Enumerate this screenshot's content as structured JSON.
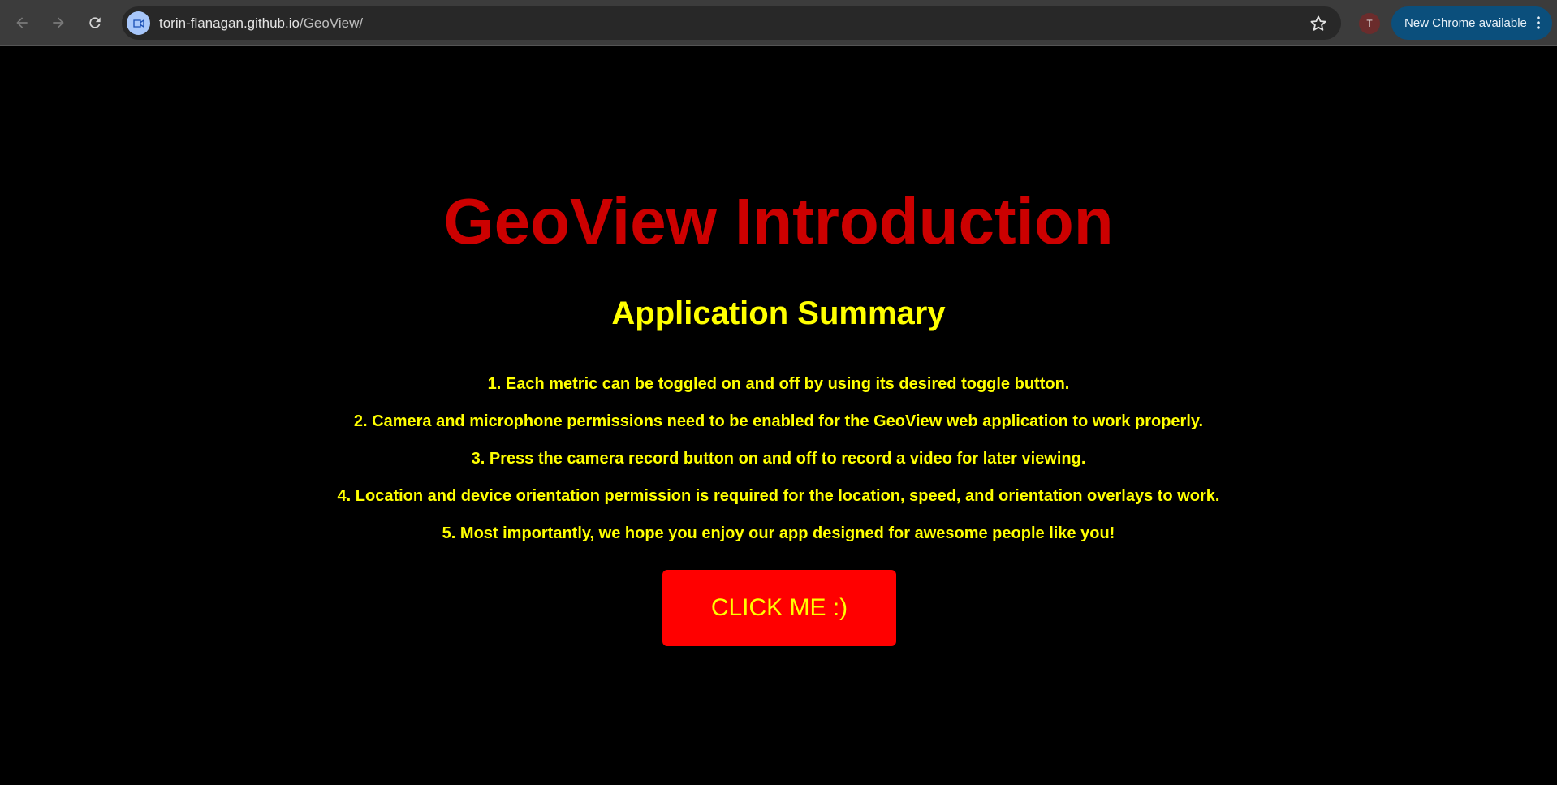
{
  "browser": {
    "url_host": "torin-flanagan.github.io",
    "url_path": "/GeoView/",
    "avatar_letter": "T",
    "update_label": "New Chrome available",
    "icons": {
      "back": "arrow-left-icon",
      "forward": "arrow-right-icon",
      "reload": "reload-icon",
      "site": "video-camera-icon",
      "bookmark": "star-icon",
      "menu": "more-vert-icon"
    }
  },
  "page": {
    "title": "GeoView Introduction",
    "subtitle": "Application Summary",
    "items": [
      "1. Each metric can be toggled on and off by using its desired toggle button.",
      "2. Camera and microphone permissions need to be enabled for the GeoView web application to work properly.",
      "3. Press the camera record button on and off to record a video for later viewing.",
      "4. Location and device orientation permission is required for the location, speed, and orientation overlays to work.",
      "5. Most importantly, we hope you enjoy our app designed for awesome people like you!"
    ],
    "button_label": "CLICK ME :)"
  },
  "colors": {
    "background": "#000000",
    "title": "#cc0000",
    "text": "#ffff00",
    "button": "#ff0000"
  }
}
